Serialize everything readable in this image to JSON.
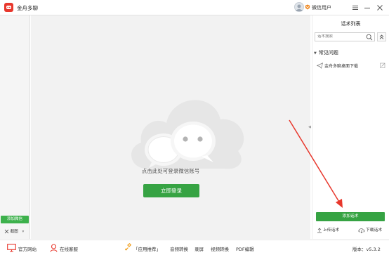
{
  "app": {
    "title": "金舟多聊"
  },
  "user": {
    "name": "微信用户"
  },
  "left": {
    "add_wechat": "添加微信",
    "screenshot": "截图"
  },
  "center": {
    "login_hint": "点击此处可登录微信账号",
    "login_button": "立即登录"
  },
  "right": {
    "title": "话术列表",
    "search_placeholder": "话术搜索",
    "faq_header": "常见问题",
    "items": [
      {
        "label": "金舟多聊桌面下载"
      }
    ],
    "add_script": "添加话术",
    "upload": "上传话术",
    "download": "下载话术"
  },
  "footer": {
    "website": "官方网站",
    "support": "在线客服",
    "recommend": "「应用推荐」",
    "links": [
      "音频转换",
      "录屏",
      "视频转换",
      "PDF编辑"
    ],
    "version_label": "版本：",
    "version": "v5.3.2"
  },
  "colors": {
    "brand_red": "#e8372c",
    "green": "#36a343"
  }
}
